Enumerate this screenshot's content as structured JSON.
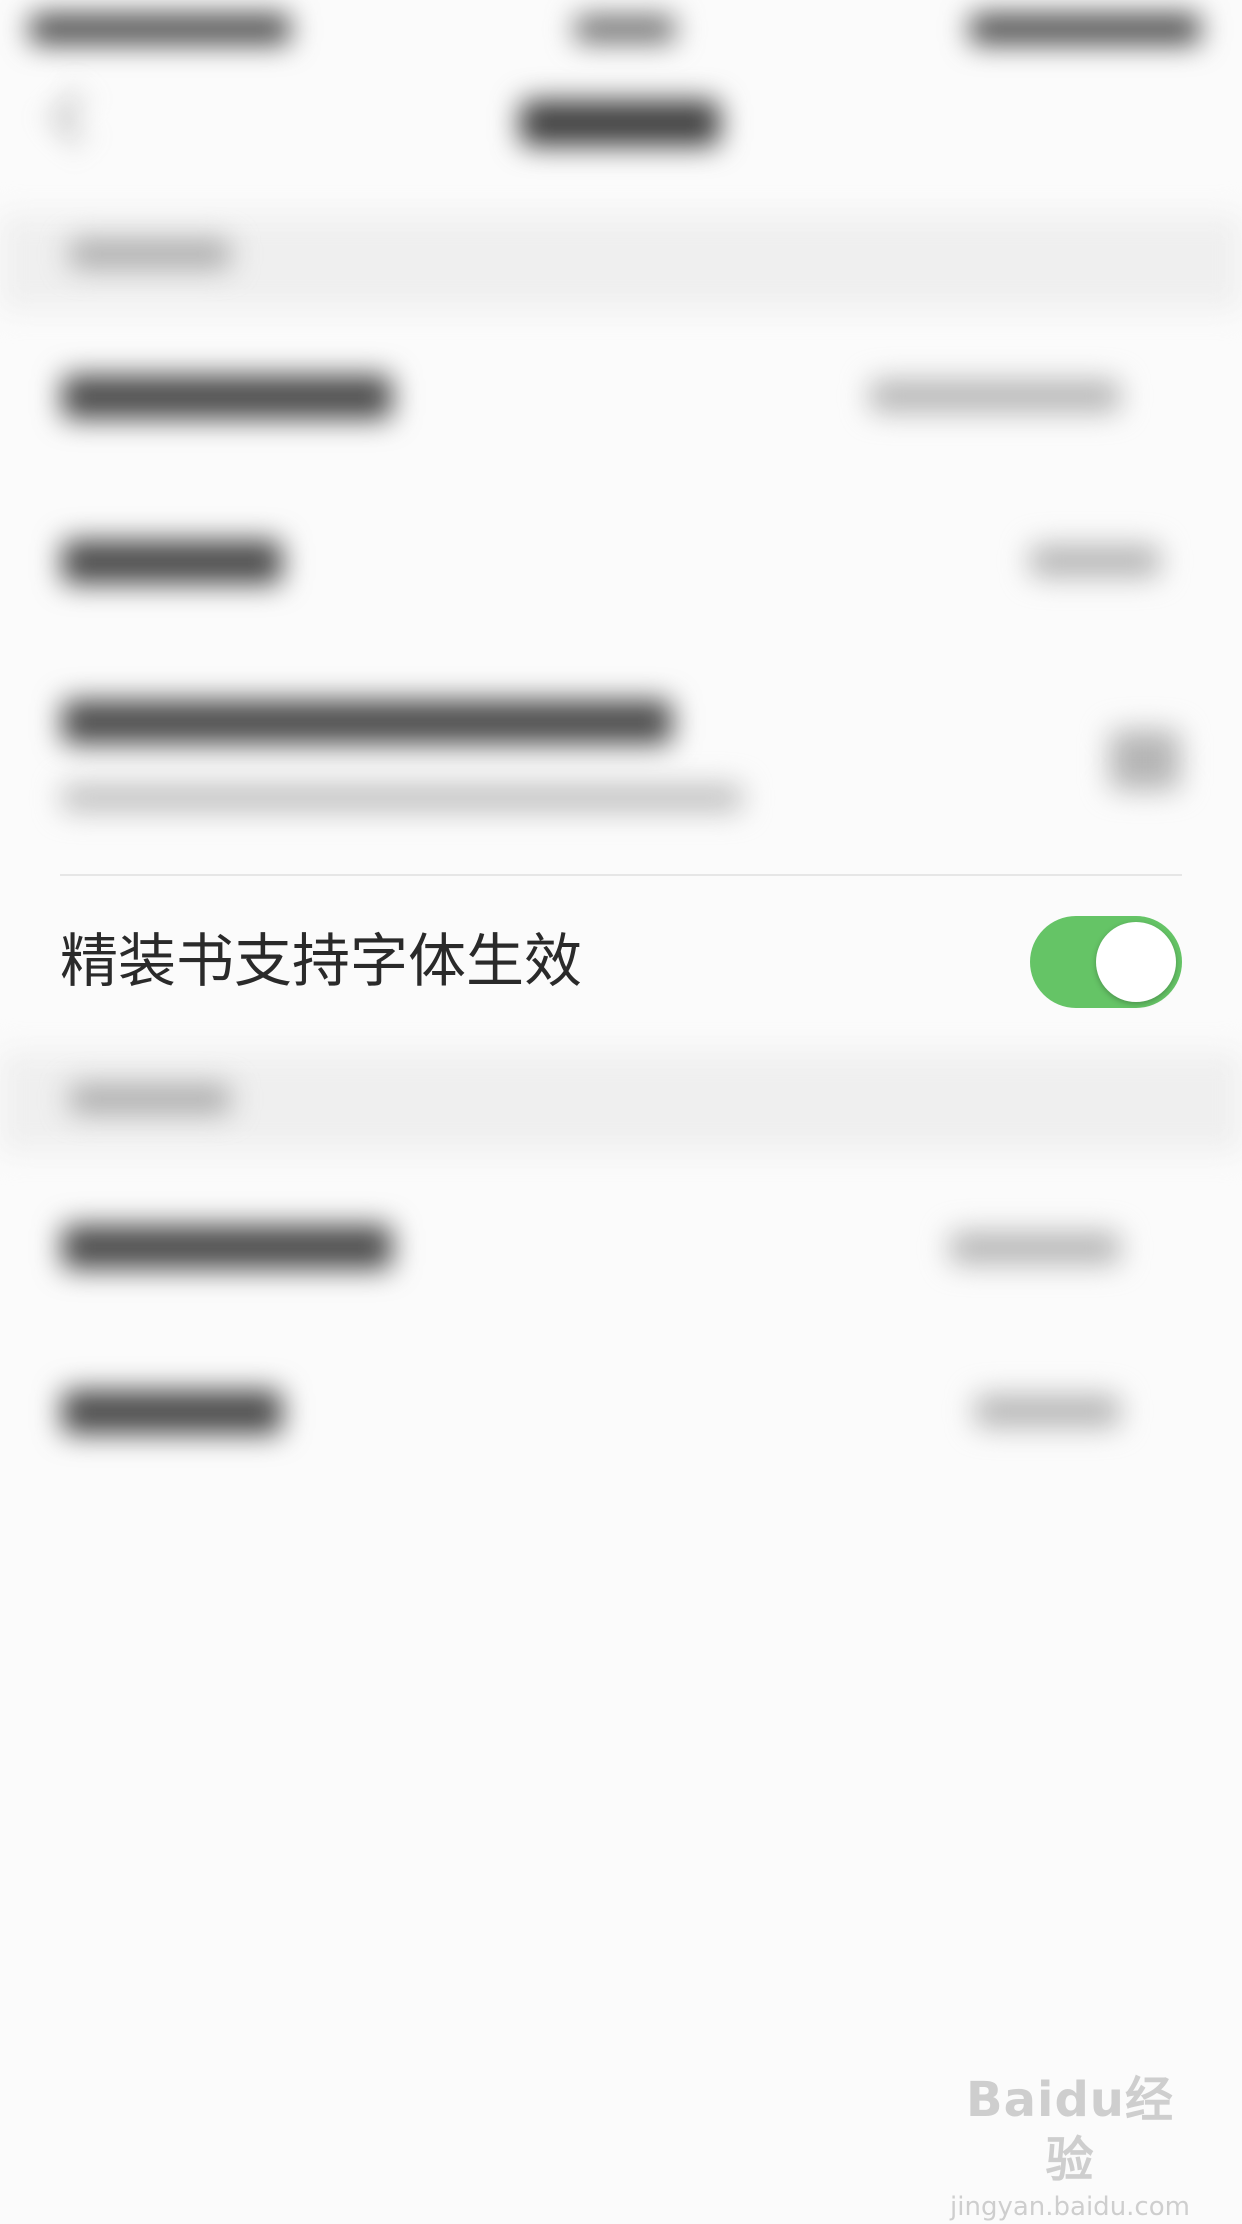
{
  "setting": {
    "label": "精装书支持字体生效",
    "toggle_on": true,
    "toggle_color": "#65c466"
  },
  "watermark": {
    "logo": "Baidu经验",
    "url": "jingyan.baidu.com"
  },
  "icons": {
    "back": "chevron-left-icon"
  }
}
